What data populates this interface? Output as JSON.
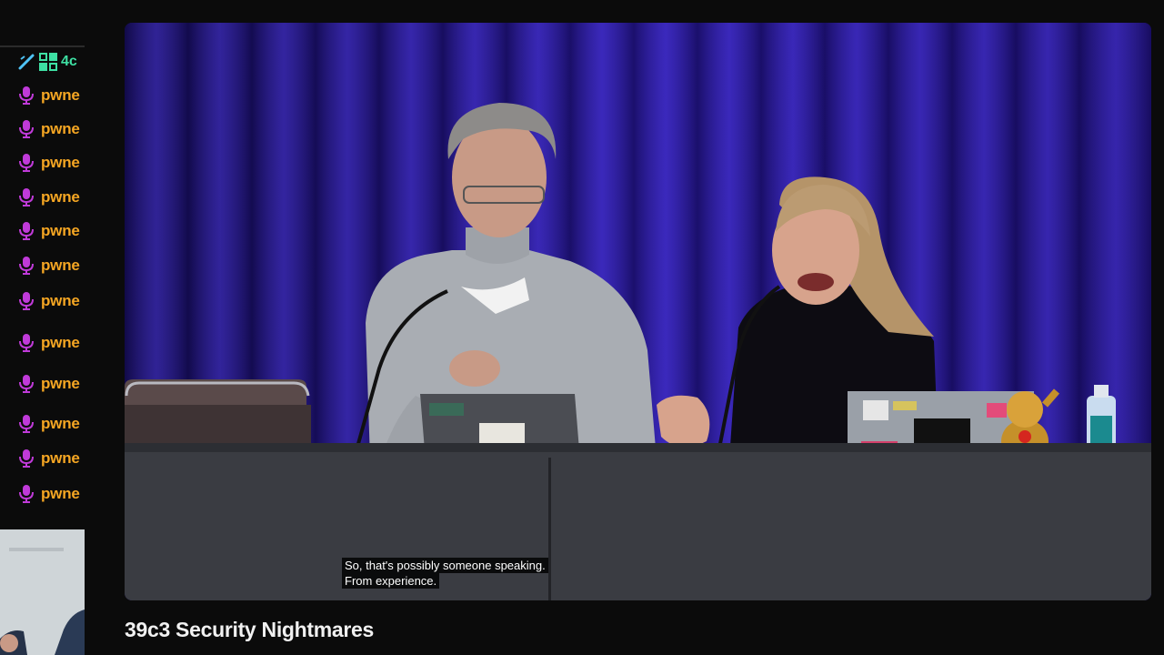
{
  "sidebar": {
    "first_item": {
      "name": "4c",
      "icon": "checkmark-badge-icon"
    },
    "items": [
      {
        "name": "pwne",
        "icon": "microphone-icon"
      },
      {
        "name": "pwne",
        "icon": "microphone-icon"
      },
      {
        "name": "pwne",
        "icon": "microphone-icon"
      },
      {
        "name": "pwne",
        "icon": "microphone-icon"
      },
      {
        "name": "pwne",
        "icon": "microphone-icon"
      },
      {
        "name": "pwne",
        "icon": "microphone-icon"
      },
      {
        "name": "pwne",
        "icon": "microphone-icon"
      },
      {
        "name": "pwne",
        "icon": "microphone-icon"
      },
      {
        "name": "pwne",
        "icon": "microphone-icon"
      },
      {
        "name": "pwne",
        "icon": "microphone-icon"
      },
      {
        "name": "pwne",
        "icon": "microphone-icon"
      },
      {
        "name": "pwne",
        "icon": "microphone-icon"
      }
    ]
  },
  "video": {
    "subtitle_line1": "So, that's possibly someone speaking.",
    "subtitle_line2": "From experience."
  },
  "title": "39c3 Security Nightmares",
  "colors": {
    "username": "#f5a623",
    "first_username": "#3ee0a3",
    "mic_icon": "#c03ad9",
    "curtain": "#2a18a8"
  }
}
